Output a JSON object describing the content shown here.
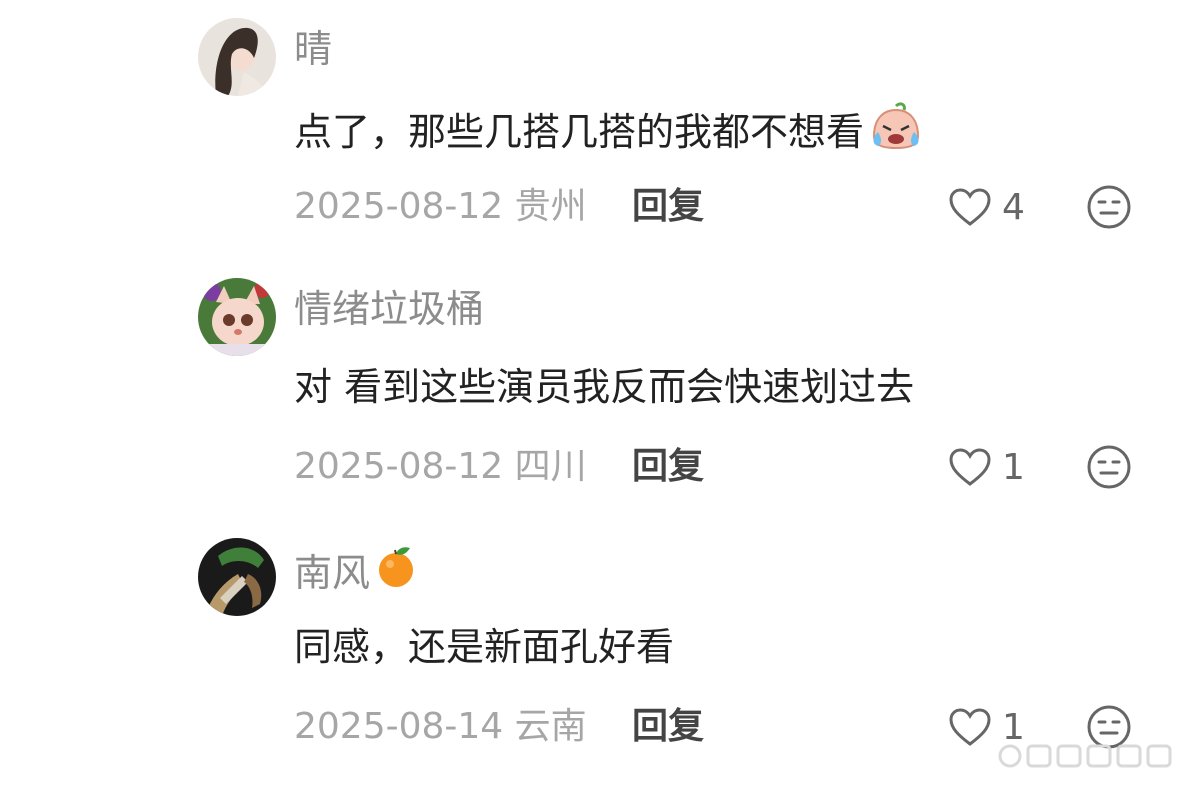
{
  "comments": [
    {
      "username": "晴",
      "text": "点了，那些几搭几搭的我都不想看",
      "date": "2025-08-12",
      "location": "贵州",
      "reply_label": "回复",
      "likes": "4",
      "trailing_emoji": "crying-laughing-emoji"
    },
    {
      "username": "情绪垃圾桶",
      "text": "对  看到这些演员我反而会快速划过去",
      "date": "2025-08-12",
      "location": "四川",
      "reply_label": "回复",
      "likes": "1"
    },
    {
      "username": "南风",
      "username_emoji": "orange-emoji",
      "text": "同感，还是新面孔好看",
      "date": "2025-08-14",
      "location": "云南",
      "reply_label": "回复",
      "likes": "1"
    }
  ],
  "colors": {
    "username": "#8c8c8c",
    "text": "#222222",
    "meta": "#a6a6a6",
    "icon": "#666666"
  }
}
